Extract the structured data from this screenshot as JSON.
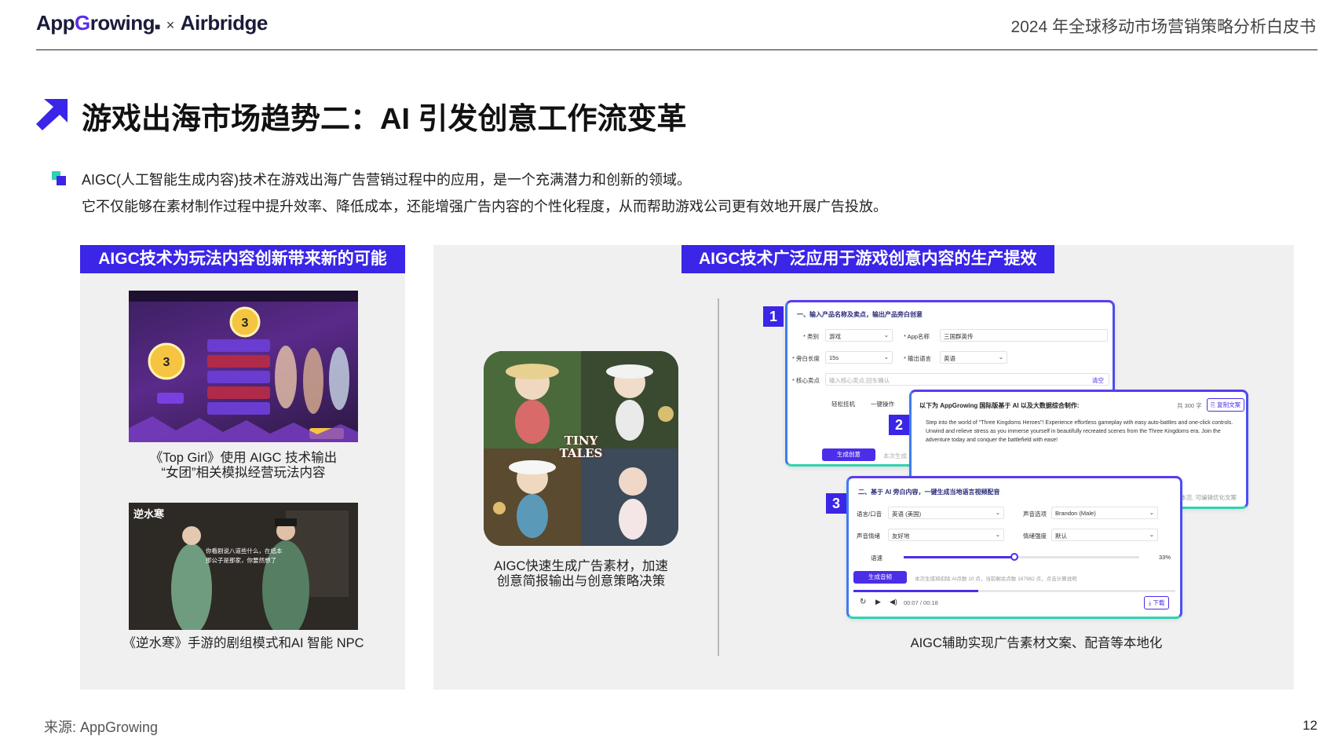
{
  "header": {
    "logo_app": "App",
    "logo_growing_g": "G",
    "logo_growing_rest": "rowing",
    "logo_times": "×",
    "logo_airbridge": "Airbridge",
    "doc_title": "2024 年全球移动市场营销策略分析白皮书"
  },
  "title": "游戏出海市场趋势二：AI 引发创意工作流变革",
  "intro": {
    "line1": "AIGC(人工智能生成内容)技术在游戏出海广告营销过程中的应用，是一个充满潜力和创新的领域。",
    "line2": "它不仅能够在素材制作过程中提升效率、降低成本，还能增强广告内容的个性化程度，从而帮助游戏公司更有效地开展广告投放。"
  },
  "left_panel": {
    "heading": "AIGC技术为玩法内容创新带来新的可能",
    "caption1_line1": "《Top Girl》使用 AIGC 技术输出",
    "caption1_line2": "“女团”相关模拟经营玩法内容",
    "caption2": "《逆水寒》手游的剧组模式和AI 智能 NPC",
    "img2_title": "逆水寒",
    "img2_subtitle_l1": "你看剧说八道些什么，在纸本",
    "img2_subtitle_l2": "那公子是那家，你要然想了"
  },
  "right_panel": {
    "heading": "AIGC技术广泛应用于游戏创意内容的生产提效",
    "tiny_tales": "TINY TALES",
    "caption_mid_line1": "AIGC快速生成广告素材，加速",
    "caption_mid_line2": "创意简报输出与创意策略决策",
    "caption_right": "AIGC辅助实现广告素材文案、配音等本地化",
    "card1": {
      "num": "1",
      "title": "一、输入产品名称及卖点，输出产品旁白创意",
      "l_category": "* 类别",
      "v_category": "游戏",
      "l_appname": "* App名称",
      "v_appname": "三国群英传",
      "l_length": "* 旁白长度",
      "v_length": "15s",
      "l_lang": "* 输出语言",
      "v_lang": "英语",
      "l_points": "* 核心卖点",
      "v_points_ph": "输入核心卖点,回车确认",
      "clear": "清空",
      "tag1": "轻松挂机",
      "tag2": "一键操作",
      "gen_btn": "生成创意",
      "note": "本次生成"
    },
    "card2": {
      "num": "2",
      "title": "以下为 AppGrowing 国际版基于 AI 以及大数据综合制作:",
      "count": "共 300 字",
      "copy_btn": "复制文案",
      "text": "Step into the world of \"Three Kingdoms Heroes\"! Experience effortless gameplay with easy auto-battles and one-click controls. Unwind and relieve stress as you immerse yourself in beautifully recreated scenes from the Three Kingdoms era. Join the adventure today and conquer the battlefield with ease!",
      "footer": "本范, 可编辑优化文案"
    },
    "card3": {
      "num": "3",
      "title": "二、基于 AI 旁白内容，一键生成当地语言视频配音",
      "l_lang": "语言/口音",
      "v_lang": "英语 (美国)",
      "l_voice": "声音选项",
      "v_voice": "Brandon (Male)",
      "l_emotion": "声音情绪",
      "v_emotion": "友好地",
      "l_intensity": "情绪强度",
      "v_intensity": "默认",
      "l_speed": "语速",
      "v_speed": "33%",
      "gen_btn": "生成音频",
      "note": "本次生成将扣除 AI点数 10 点，当前剩余点数 167982 点，点击计算说明",
      "time": "00:07 / 00:18",
      "download": "下载"
    }
  },
  "footer": {
    "source": "来源: AppGrowing",
    "page": "12"
  },
  "colors": {
    "accent": "#3b25e6",
    "panel_bg": "#f0f0f0",
    "teal": "#2fd3b2"
  }
}
